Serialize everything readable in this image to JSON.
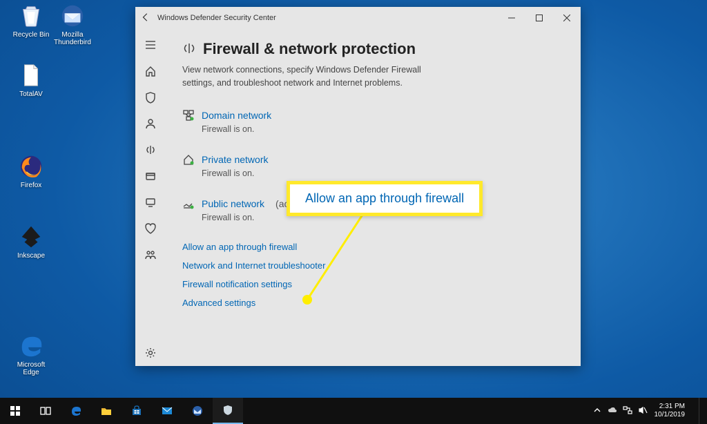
{
  "desktop": {
    "icons": [
      {
        "label": "Recycle Bin"
      },
      {
        "label": "Mozilla\nThunderbird"
      },
      {
        "label": "TotalAV"
      },
      {
        "label": "Firefox"
      },
      {
        "label": "Inkscape"
      },
      {
        "label": "Microsoft\nEdge"
      }
    ]
  },
  "window": {
    "title": "Windows Defender Security Center",
    "nav_items": [
      "menu",
      "home",
      "shield",
      "account",
      "firewall",
      "app-control",
      "device",
      "health",
      "family",
      "settings"
    ],
    "page": {
      "title": "Firewall & network protection",
      "description": "View network connections, specify Windows Defender Firewall settings, and troubleshoot network and Internet problems.",
      "networks": [
        {
          "label": "Domain network",
          "active": "",
          "status": "Firewall is on."
        },
        {
          "label": "Private network",
          "active": "",
          "status": "Firewall is on."
        },
        {
          "label": "Public network",
          "active": " (active)",
          "status": "Firewall is on."
        }
      ],
      "links": [
        "Allow an app through firewall",
        "Network and Internet troubleshooter",
        "Firewall notification settings",
        "Advanced settings"
      ]
    }
  },
  "annotation": {
    "callout": "Allow an app through firewall"
  },
  "taskbar": {
    "time": "2:31 PM",
    "date": "10/1/2019"
  }
}
